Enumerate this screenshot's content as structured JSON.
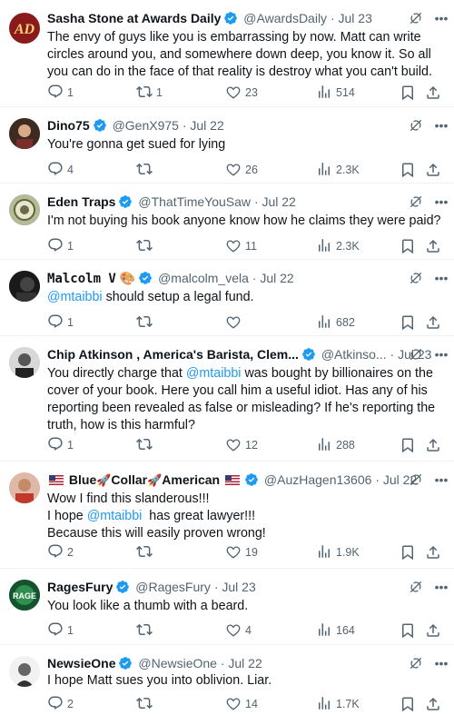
{
  "colors": {
    "text": "#0f1419",
    "muted": "#536471",
    "link": "#1d9bf0",
    "verified": "#1d9bf0"
  },
  "tweets": [
    {
      "name": "Sasha Stone at Awards Daily",
      "handle": "@AwardsDaily",
      "date": "· Jul 23",
      "text": "The envy of guys like you is embarrassing by now. Matt can write circles around you, and somewhere down deep, you know it. So all you can do in the face of that reality is destroy what you can't build.",
      "replies": "1",
      "retweets": "1",
      "likes": "23",
      "views": "514"
    },
    {
      "name": "Dino75",
      "handle": "@GenX975",
      "date": "· Jul 22",
      "text": "You're gonna get sued for lying",
      "replies": "4",
      "retweets": "",
      "likes": "26",
      "views": "2.3K"
    },
    {
      "name": "Eden Traps",
      "handle": "@ThatTimeYouSaw",
      "date": "· Jul 22",
      "text": "I'm not buying his book anyone know how he claims they were paid?",
      "replies": "1",
      "retweets": "",
      "likes": "11",
      "views": "2.3K"
    },
    {
      "name": "Malcolm V",
      "name_emoji": "🎨",
      "handle": "@malcolm_vela",
      "date": "· Jul 22",
      "mention": "@mtaibbi",
      "text": " should setup a legal fund.",
      "replies": "1",
      "retweets": "",
      "likes": "",
      "views": "682"
    },
    {
      "name": "Chip Atkinson , America's Barista, Clem...",
      "handle": "@Atkinso...",
      "date": "· Jul 23",
      "text_a": "You directly charge that ",
      "mention": "@mtaibbi",
      "text_b": " was bought by billionaires on the cover of your book. Here you call him a useful idiot. Has any of his reporting been revealed as false or misleading? If he's reporting the truth, how is this harmful?",
      "replies": "1",
      "retweets": "",
      "likes": "12",
      "views": "288"
    },
    {
      "name_parts": [
        "Blue",
        "🚀",
        "Collar",
        "🚀",
        "American"
      ],
      "handle": "@AuzHagen13606",
      "date": "· Jul 22",
      "line1": "Wow I find this slanderous!!!",
      "line2_a": "I hope ",
      "mention": "@mtaibbi",
      "line2_b": "  has great lawyer!!!",
      "line3": "Because this will easily proven wrong!",
      "replies": "2",
      "retweets": "",
      "likes": "19",
      "views": "1.9K"
    },
    {
      "name": "RagesFury",
      "handle": "@RagesFury",
      "date": "· Jul 23",
      "text": "You look like a thumb with a beard.",
      "replies": "1",
      "retweets": "",
      "likes": "4",
      "views": "164"
    },
    {
      "name": "NewsieOne",
      "handle": "@NewsieOne",
      "date": "· Jul 22",
      "text": "I hope Matt sues you into oblivion. Liar.",
      "replies": "2",
      "retweets": "",
      "likes": "14",
      "views": "1.7K"
    }
  ]
}
